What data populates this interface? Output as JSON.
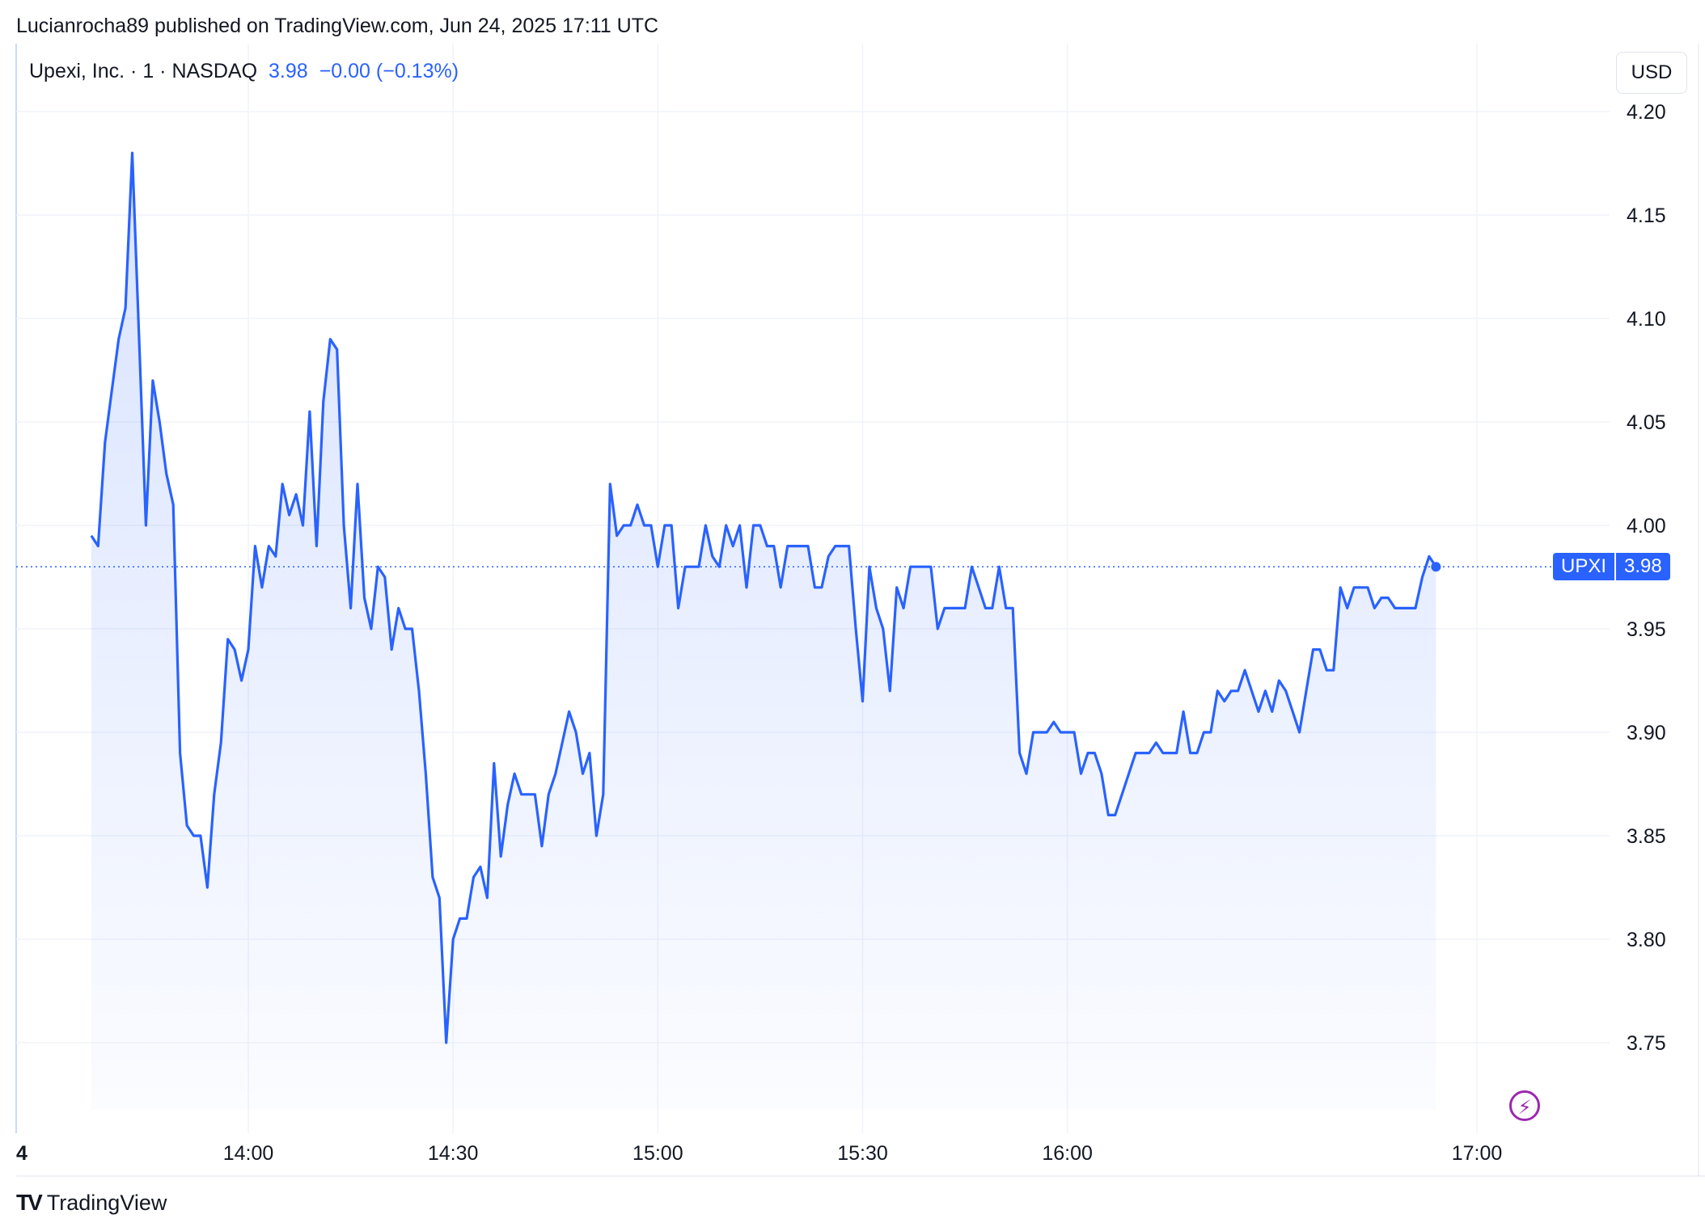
{
  "header": {
    "published_text": "Lucianrocha89 published on TradingView.com, Jun 24, 2025 17:11 UTC"
  },
  "legend": {
    "symbol_text": "Upexi, Inc. · 1 · NASDAQ",
    "last_price": "3.98",
    "change": "−0.00 (−0.13%)"
  },
  "currency_button": "USD",
  "price_tag": {
    "symbol": "UPXI",
    "value": "3.98"
  },
  "brand": {
    "name": "TradingView"
  },
  "colors": {
    "line": "#2962ff",
    "grid": "#f0f3fa",
    "bolt": "#9c27b0"
  },
  "icons": {
    "bolt": "lightning-bolt-icon",
    "logo": "tradingview-logo-icon"
  },
  "chart_data": {
    "type": "area",
    "currency": "USD",
    "ylim": [
      3.72,
      4.23
    ],
    "yticks": [
      4.2,
      4.15,
      4.1,
      4.05,
      4.0,
      3.95,
      3.9,
      3.85,
      3.8,
      3.75
    ],
    "ytick_labels": [
      "4.20",
      "4.15",
      "4.10",
      "4.05",
      "4.00",
      "3.95",
      "3.90",
      "3.85",
      "3.80",
      "3.75"
    ],
    "x_unit": "minutes",
    "xlim": [
      "13:37",
      "17:17"
    ],
    "xticks": [
      {
        "time": "13:37",
        "label": "4"
      },
      {
        "time": "14:00",
        "label": "14:00"
      },
      {
        "time": "14:30",
        "label": "14:30"
      },
      {
        "time": "15:00",
        "label": "15:00"
      },
      {
        "time": "15:30",
        "label": "15:30"
      },
      {
        "time": "16:00",
        "label": "16:00"
      },
      {
        "time": "17:00",
        "label": "17:00"
      }
    ],
    "last_value": 3.98,
    "grid": true,
    "points": [
      [
        "13:37",
        3.995
      ],
      [
        "13:38",
        3.99
      ],
      [
        "13:39",
        4.04
      ],
      [
        "13:40",
        4.065
      ],
      [
        "13:41",
        4.09
      ],
      [
        "13:42",
        4.105
      ],
      [
        "13:43",
        4.18
      ],
      [
        "13:44",
        4.09
      ],
      [
        "13:45",
        4.0
      ],
      [
        "13:46",
        4.07
      ],
      [
        "13:47",
        4.05
      ],
      [
        "13:48",
        4.025
      ],
      [
        "13:49",
        4.01
      ],
      [
        "13:50",
        3.89
      ],
      [
        "13:51",
        3.855
      ],
      [
        "13:52",
        3.85
      ],
      [
        "13:53",
        3.85
      ],
      [
        "13:54",
        3.825
      ],
      [
        "13:55",
        3.87
      ],
      [
        "13:56",
        3.895
      ],
      [
        "13:57",
        3.945
      ],
      [
        "13:58",
        3.94
      ],
      [
        "13:59",
        3.925
      ],
      [
        "14:00",
        3.94
      ],
      [
        "14:01",
        3.99
      ],
      [
        "14:02",
        3.97
      ],
      [
        "14:03",
        3.99
      ],
      [
        "14:04",
        3.985
      ],
      [
        "14:05",
        4.02
      ],
      [
        "14:06",
        4.005
      ],
      [
        "14:07",
        4.015
      ],
      [
        "14:08",
        4.0
      ],
      [
        "14:09",
        4.055
      ],
      [
        "14:10",
        3.99
      ],
      [
        "14:11",
        4.06
      ],
      [
        "14:12",
        4.09
      ],
      [
        "14:13",
        4.085
      ],
      [
        "14:14",
        4.0
      ],
      [
        "14:15",
        3.96
      ],
      [
        "14:16",
        4.02
      ],
      [
        "14:17",
        3.965
      ],
      [
        "14:18",
        3.95
      ],
      [
        "14:19",
        3.98
      ],
      [
        "14:20",
        3.975
      ],
      [
        "14:21",
        3.94
      ],
      [
        "14:22",
        3.96
      ],
      [
        "14:23",
        3.95
      ],
      [
        "14:24",
        3.95
      ],
      [
        "14:25",
        3.92
      ],
      [
        "14:26",
        3.88
      ],
      [
        "14:27",
        3.83
      ],
      [
        "14:28",
        3.82
      ],
      [
        "14:29",
        3.75
      ],
      [
        "14:30",
        3.8
      ],
      [
        "14:31",
        3.81
      ],
      [
        "14:32",
        3.81
      ],
      [
        "14:33",
        3.83
      ],
      [
        "14:34",
        3.835
      ],
      [
        "14:35",
        3.82
      ],
      [
        "14:36",
        3.885
      ],
      [
        "14:37",
        3.84
      ],
      [
        "14:38",
        3.865
      ],
      [
        "14:39",
        3.88
      ],
      [
        "14:40",
        3.87
      ],
      [
        "14:41",
        3.87
      ],
      [
        "14:42",
        3.87
      ],
      [
        "14:43",
        3.845
      ],
      [
        "14:44",
        3.87
      ],
      [
        "14:45",
        3.88
      ],
      [
        "14:46",
        3.895
      ],
      [
        "14:47",
        3.91
      ],
      [
        "14:48",
        3.9
      ],
      [
        "14:49",
        3.88
      ],
      [
        "14:50",
        3.89
      ],
      [
        "14:51",
        3.85
      ],
      [
        "14:52",
        3.87
      ],
      [
        "14:53",
        4.02
      ],
      [
        "14:54",
        3.995
      ],
      [
        "14:55",
        4.0
      ],
      [
        "14:56",
        4.0
      ],
      [
        "14:57",
        4.01
      ],
      [
        "14:58",
        4.0
      ],
      [
        "14:59",
        4.0
      ],
      [
        "15:00",
        3.98
      ],
      [
        "15:01",
        4.0
      ],
      [
        "15:02",
        4.0
      ],
      [
        "15:03",
        3.96
      ],
      [
        "15:04",
        3.98
      ],
      [
        "15:05",
        3.98
      ],
      [
        "15:06",
        3.98
      ],
      [
        "15:07",
        4.0
      ],
      [
        "15:08",
        3.985
      ],
      [
        "15:09",
        3.98
      ],
      [
        "15:10",
        4.0
      ],
      [
        "15:11",
        3.99
      ],
      [
        "15:12",
        4.0
      ],
      [
        "15:13",
        3.97
      ],
      [
        "15:14",
        4.0
      ],
      [
        "15:15",
        4.0
      ],
      [
        "15:16",
        3.99
      ],
      [
        "15:17",
        3.99
      ],
      [
        "15:18",
        3.97
      ],
      [
        "15:19",
        3.99
      ],
      [
        "15:20",
        3.99
      ],
      [
        "15:21",
        3.99
      ],
      [
        "15:22",
        3.99
      ],
      [
        "15:23",
        3.97
      ],
      [
        "15:24",
        3.97
      ],
      [
        "15:25",
        3.985
      ],
      [
        "15:26",
        3.99
      ],
      [
        "15:27",
        3.99
      ],
      [
        "15:28",
        3.99
      ],
      [
        "15:29",
        3.95
      ],
      [
        "15:30",
        3.915
      ],
      [
        "15:31",
        3.98
      ],
      [
        "15:32",
        3.96
      ],
      [
        "15:33",
        3.95
      ],
      [
        "15:34",
        3.92
      ],
      [
        "15:35",
        3.97
      ],
      [
        "15:36",
        3.96
      ],
      [
        "15:37",
        3.98
      ],
      [
        "15:38",
        3.98
      ],
      [
        "15:39",
        3.98
      ],
      [
        "15:40",
        3.98
      ],
      [
        "15:41",
        3.95
      ],
      [
        "15:42",
        3.96
      ],
      [
        "15:43",
        3.96
      ],
      [
        "15:44",
        3.96
      ],
      [
        "15:45",
        3.96
      ],
      [
        "15:46",
        3.98
      ],
      [
        "15:47",
        3.97
      ],
      [
        "15:48",
        3.96
      ],
      [
        "15:49",
        3.96
      ],
      [
        "15:50",
        3.98
      ],
      [
        "15:51",
        3.96
      ],
      [
        "15:52",
        3.96
      ],
      [
        "15:53",
        3.89
      ],
      [
        "15:54",
        3.88
      ],
      [
        "15:55",
        3.9
      ],
      [
        "15:56",
        3.9
      ],
      [
        "15:57",
        3.9
      ],
      [
        "15:58",
        3.905
      ],
      [
        "15:59",
        3.9
      ],
      [
        "16:00",
        3.9
      ],
      [
        "16:01",
        3.9
      ],
      [
        "16:02",
        3.88
      ],
      [
        "16:03",
        3.89
      ],
      [
        "16:04",
        3.89
      ],
      [
        "16:05",
        3.88
      ],
      [
        "16:06",
        3.86
      ],
      [
        "16:07",
        3.86
      ],
      [
        "16:08",
        3.87
      ],
      [
        "16:09",
        3.88
      ],
      [
        "16:10",
        3.89
      ],
      [
        "16:11",
        3.89
      ],
      [
        "16:12",
        3.89
      ],
      [
        "16:13",
        3.895
      ],
      [
        "16:14",
        3.89
      ],
      [
        "16:15",
        3.89
      ],
      [
        "16:16",
        3.89
      ],
      [
        "16:17",
        3.91
      ],
      [
        "16:18",
        3.89
      ],
      [
        "16:19",
        3.89
      ],
      [
        "16:20",
        3.9
      ],
      [
        "16:21",
        3.9
      ],
      [
        "16:22",
        3.92
      ],
      [
        "16:23",
        3.915
      ],
      [
        "16:24",
        3.92
      ],
      [
        "16:25",
        3.92
      ],
      [
        "16:26",
        3.93
      ],
      [
        "16:27",
        3.92
      ],
      [
        "16:28",
        3.91
      ],
      [
        "16:29",
        3.92
      ],
      [
        "16:30",
        3.91
      ],
      [
        "16:31",
        3.925
      ],
      [
        "16:32",
        3.92
      ],
      [
        "16:33",
        3.91
      ],
      [
        "16:34",
        3.9
      ],
      [
        "16:35",
        3.92
      ],
      [
        "16:36",
        3.94
      ],
      [
        "16:37",
        3.94
      ],
      [
        "16:38",
        3.93
      ],
      [
        "16:39",
        3.93
      ],
      [
        "16:40",
        3.97
      ],
      [
        "16:41",
        3.96
      ],
      [
        "16:42",
        3.97
      ],
      [
        "16:43",
        3.97
      ],
      [
        "16:44",
        3.97
      ],
      [
        "16:45",
        3.96
      ],
      [
        "16:46",
        3.965
      ],
      [
        "16:47",
        3.965
      ],
      [
        "16:48",
        3.96
      ],
      [
        "16:49",
        3.96
      ],
      [
        "16:50",
        3.96
      ],
      [
        "16:51",
        3.96
      ],
      [
        "16:52",
        3.975
      ],
      [
        "16:53",
        3.985
      ],
      [
        "16:54",
        3.98
      ]
    ]
  }
}
